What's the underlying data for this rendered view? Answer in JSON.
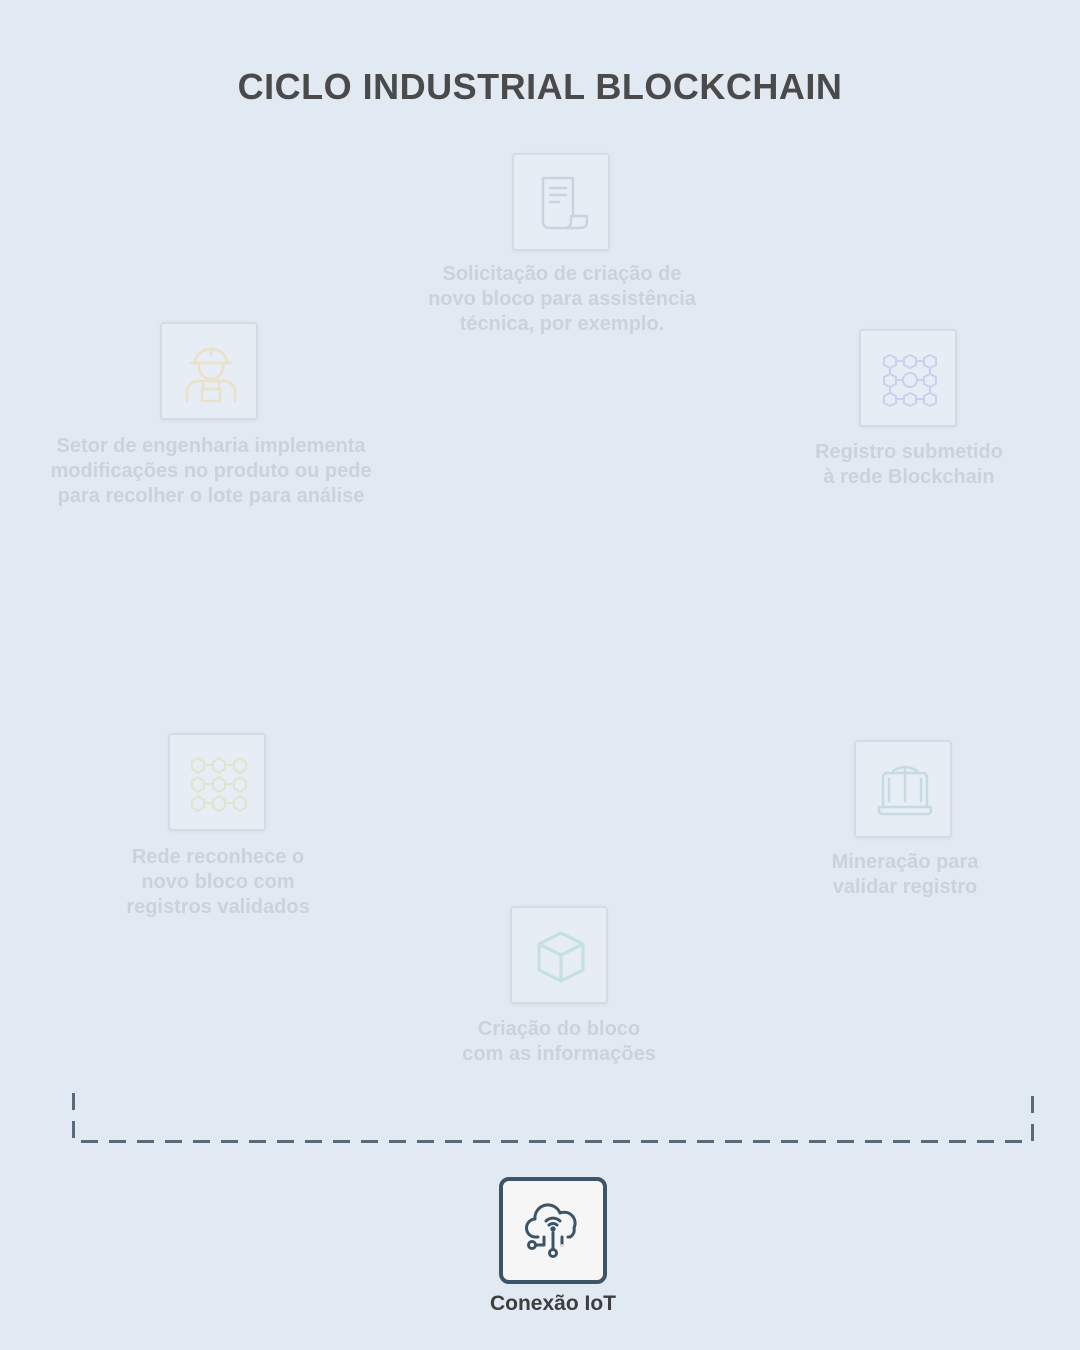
{
  "title": "CICLO INDUSTRIAL BLOCKCHAIN",
  "steps": [
    {
      "icon": "document-scroll-icon",
      "label": "Solicitação de criação de\nnovo bloco para assistência\ntécnica, por exemplo.",
      "color": "#c9d3e2"
    },
    {
      "icon": "blockchain-network-icon",
      "label": "Registro submetido\nà rede Blockchain",
      "color": "#c8d1ee"
    },
    {
      "icon": "mining-pickaxe-laptop-icon",
      "label": "Mineração para\nvalidar registro",
      "color": "#c6dbe0"
    },
    {
      "icon": "cube-block-icon",
      "label": "Criação do bloco\ncom as informações",
      "color": "#c4e0e0"
    },
    {
      "icon": "block-grid-network-icon",
      "label": "Rede reconhece o\nnovo bloco com\nregistros validados",
      "color": "#e1e5cf"
    },
    {
      "icon": "engineer-worker-icon",
      "label": "Setor de engenharia implementa\nmodificações no produto ou pede\npara recolher o lote para análise",
      "color": "#ebe0c8"
    }
  ],
  "iot": {
    "icon": "cloud-iot-icon",
    "label": "Conexão IoT",
    "color": "#3c5468"
  },
  "colors": {
    "background": "#e1eaf2",
    "title": "#4a4a4a",
    "faded_label": "#cbd2d9",
    "dash": "#566b7c"
  }
}
